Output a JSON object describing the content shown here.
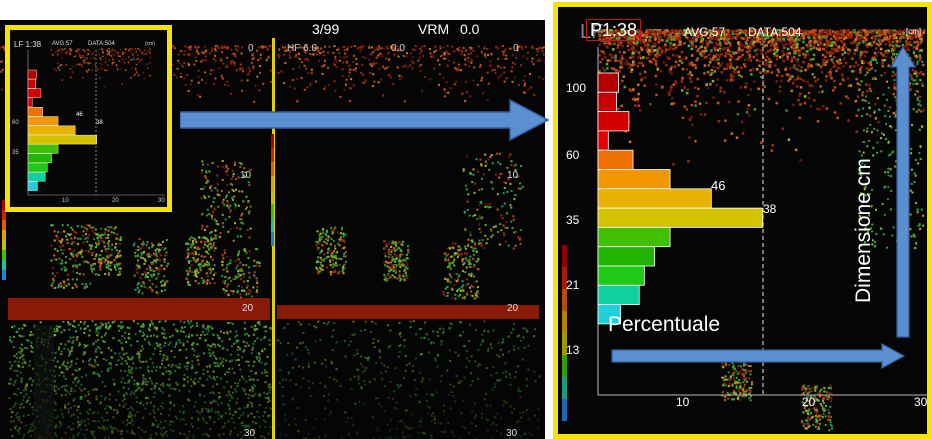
{
  "left_panel": {
    "header": {
      "page": "3/99",
      "vrm_label": "VRM",
      "vrm_value": "0.0",
      "range_label": "HF 6.0",
      "range_value": "0.0",
      "left_zero": "0",
      "right_zero": "0"
    },
    "depth_ticks": {
      "mid_left": "10",
      "mid_right": "10",
      "low_left": "20",
      "low_right": "20",
      "bottom_left": "30",
      "bottom_right": "30"
    },
    "inset": {
      "title": "LF 1:38",
      "avg": "AVG:57",
      "data": "DATA:504",
      "unit": "(cm)",
      "y_labels": [
        "60",
        "35"
      ],
      "bar_labels": [
        "46",
        "38"
      ],
      "x_labels": [
        "10",
        "20",
        "30"
      ]
    }
  },
  "right_panel": {
    "title_prefix": "LF",
    "title_box": "P1:38",
    "avg": "AVG:57",
    "data": "DATA:504",
    "unit": "[cm]",
    "y_labels": [
      "100",
      "60",
      "35",
      "21",
      "13"
    ],
    "x_labels": [
      "10",
      "20",
      "30"
    ],
    "histogram": {
      "values": [
        2,
        1.8,
        3,
        1,
        3.4,
        7,
        11,
        16,
        7,
        5.5,
        4.5,
        4,
        2.2
      ],
      "labels": [
        {
          "index": 6,
          "text": "46"
        },
        {
          "index": 7,
          "text": "38"
        }
      ],
      "colors": [
        "#b50000",
        "#c80000",
        "#d40000",
        "#e00000",
        "#ee7000",
        "#f19700",
        "#e8b300",
        "#d4c400",
        "#40c000",
        "#22b400",
        "#20c818",
        "#10d0a0",
        "#20d0d8"
      ]
    },
    "annotation_vertical": "Dimensione cm",
    "annotation_horizontal": "Percentuale"
  },
  "colors": {
    "highlight": "#f4e400",
    "arrow": "#5b8fd0",
    "arrow_stroke": "#2f5f9f"
  }
}
